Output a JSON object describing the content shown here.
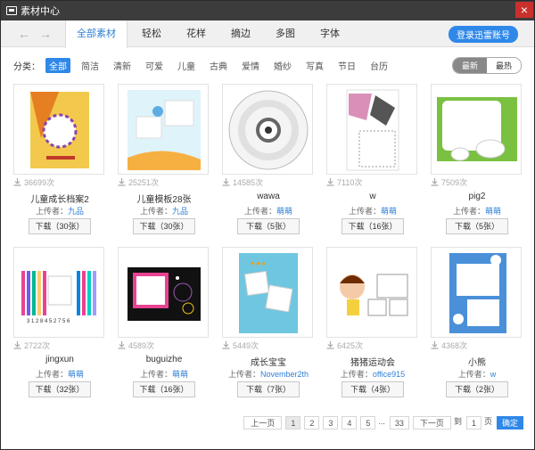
{
  "window": {
    "title": "素材中心",
    "close_symbol": "×"
  },
  "nav": {
    "tabs": [
      "全部素材",
      "轻松",
      "花样",
      "摘边",
      "多图",
      "字体"
    ],
    "active_tab": 0,
    "login_label": "登录迅雷账号"
  },
  "filters": {
    "label": "分类：",
    "items": [
      "全部",
      "简洁",
      "清新",
      "可爱",
      "儿童",
      "古典",
      "爱情",
      "婚纱",
      "写真",
      "节日",
      "台历"
    ],
    "active": 0
  },
  "sort": {
    "newest": "最新",
    "hottest": "最热"
  },
  "uploader_prefix": "上传者：",
  "items": [
    {
      "count": "36699次",
      "name": "儿童成长档案2",
      "uploader": "九品",
      "download": "下载（30张）",
      "thumb": "child-archive"
    },
    {
      "count": "25251次",
      "name": "儿童模板28张",
      "uploader": "九品",
      "download": "下载（30张）",
      "thumb": "child-template"
    },
    {
      "count": "14585次",
      "name": "wawa",
      "uploader": "萌萌",
      "download": "下载（5张）",
      "thumb": "cd"
    },
    {
      "count": "7110次",
      "name": "w",
      "uploader": "萌萌",
      "download": "下载（16张）",
      "thumb": "w"
    },
    {
      "count": "7509次",
      "name": "pig2",
      "uploader": "萌萌",
      "download": "下载（5张）",
      "thumb": "pig"
    },
    {
      "count": "2722次",
      "name": "jingxun",
      "uploader": "萌萌",
      "download": "下载（32张）",
      "thumb": "stripes"
    },
    {
      "count": "4589次",
      "name": "buguizhe",
      "uploader": "萌萌",
      "download": "下载（16张）",
      "thumb": "dark"
    },
    {
      "count": "5449次",
      "name": "成长宝宝",
      "uploader": "November2th",
      "download": "下载（7张）",
      "thumb": "baby"
    },
    {
      "count": "6425次",
      "name": "猪猪运动会",
      "uploader": "office915",
      "download": "下载（4张）",
      "thumb": "sports"
    },
    {
      "count": "4368次",
      "name": "小熊",
      "uploader": "w",
      "download": "下载（2张）",
      "thumb": "bear"
    }
  ],
  "pager": {
    "prev": "上一页",
    "pages": [
      "1",
      "2",
      "3",
      "4",
      "5",
      "...",
      "33"
    ],
    "current": "1",
    "next": "下一页",
    "goto_prefix": "到",
    "goto_value": "1",
    "goto_suffix": "页",
    "confirm": "确定"
  },
  "colors": {
    "accent": "#2f88e8",
    "link": "#2f7fd6",
    "titlebar": "#3c3c3c",
    "close": "#c9302c"
  }
}
